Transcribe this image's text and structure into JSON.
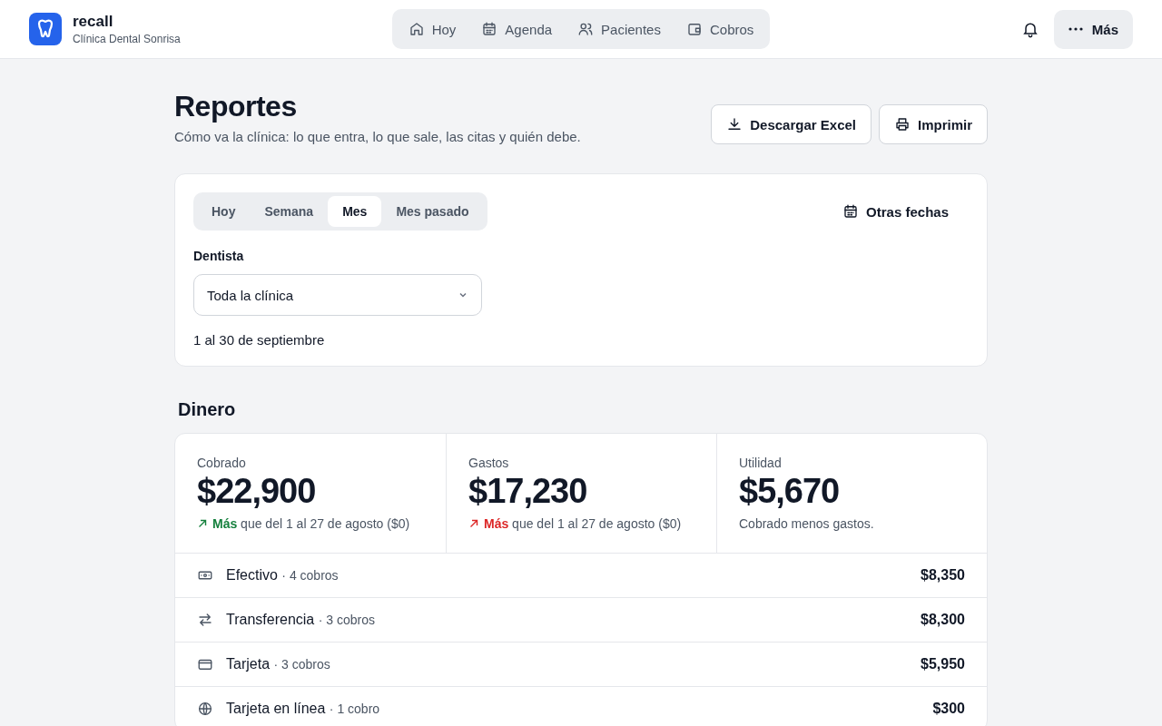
{
  "brand": {
    "name": "recall",
    "subtitle": "Clínica Dental Sonrisa"
  },
  "nav": [
    {
      "label": "Hoy",
      "selected": false
    },
    {
      "label": "Agenda",
      "selected": false
    },
    {
      "label": "Pacientes",
      "selected": false
    },
    {
      "label": "Cobros",
      "selected": false
    }
  ],
  "more_button": "Más",
  "page": {
    "title": "Reportes",
    "subtitle": "Cómo va la clínica: lo que entra, lo que sale, las citas y quién debe.",
    "actions": [
      {
        "label": "Descargar Excel"
      },
      {
        "label": "Imprimir"
      }
    ]
  },
  "filters": {
    "periods": [
      {
        "label": "Hoy",
        "selected": false
      },
      {
        "label": "Semana",
        "selected": false
      },
      {
        "label": "Mes",
        "selected": true
      },
      {
        "label": "Mes pasado",
        "selected": false
      }
    ],
    "other_dates": "Otras fechas",
    "dentist_label": "Dentista",
    "dentist_value": "Toda la clínica",
    "range": "1 al 30 de septiembre"
  },
  "money": {
    "title": "Dinero",
    "stats": [
      {
        "label": "Cobrado",
        "value": "$22,900",
        "kind": "trend",
        "color": "#15803d",
        "trend_word": "Más",
        "trend_rest": "que del 1 al 27 de agosto ($0)"
      },
      {
        "label": "Gastos",
        "value": "$17,230",
        "kind": "trend",
        "color": "#dc2626",
        "trend_word": "Más",
        "trend_rest": "que del 1 al 27 de agosto ($0)"
      },
      {
        "label": "Utilidad",
        "value": "$5,670",
        "kind": "note",
        "note": "Cobrado menos gastos."
      }
    ],
    "methods": [
      {
        "name": "Efectivo",
        "count": "· 4 cobros",
        "amount": "$8,350"
      },
      {
        "name": "Transferencia",
        "count": "· 3 cobros",
        "amount": "$8,300"
      },
      {
        "name": "Tarjeta",
        "count": "· 3 cobros",
        "amount": "$5,950"
      },
      {
        "name": "Tarjeta en línea",
        "count": "· 1 cobro",
        "amount": "$300"
      }
    ]
  }
}
